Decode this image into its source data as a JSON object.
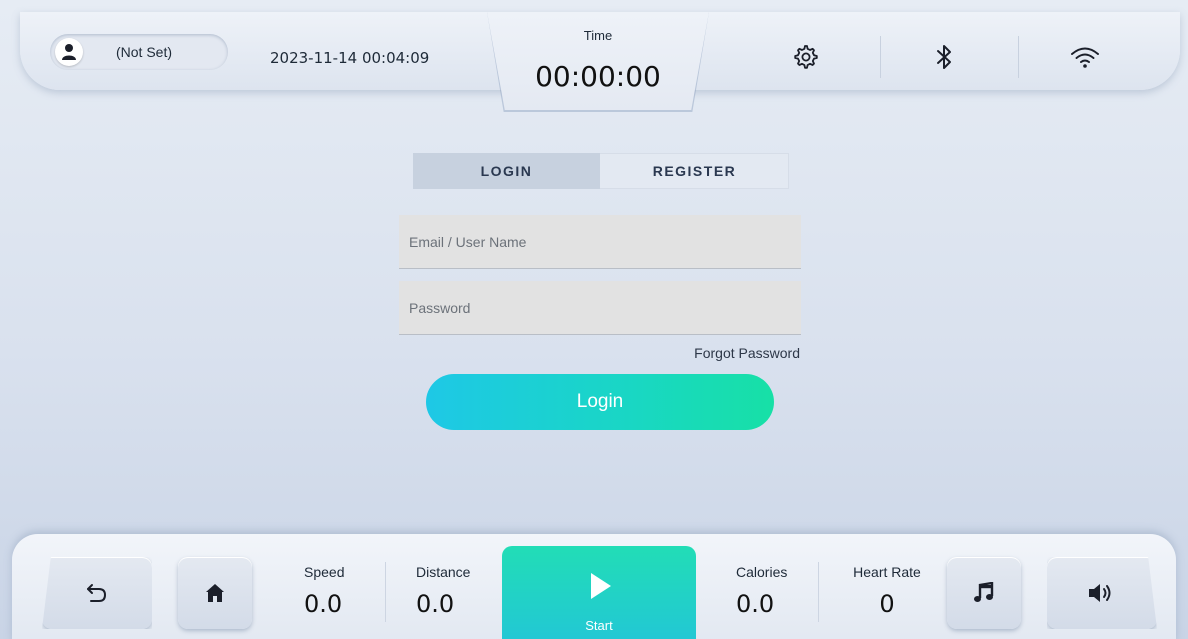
{
  "top_bar": {
    "user_name": "(Not Set)",
    "datetime": "2023-11-14 00:04:09",
    "time_label": "Time",
    "time_value": "00:00:00",
    "icons": [
      "settings-gear-icon",
      "bluetooth-icon",
      "wifi-icon"
    ]
  },
  "auth": {
    "tabs": [
      {
        "label": "LOGIN",
        "active": true
      },
      {
        "label": "REGISTER",
        "active": false
      }
    ],
    "email_placeholder": "Email / User Name",
    "email_value": "",
    "password_placeholder": "Password",
    "password_value": "",
    "forgot_password": "Forgot Password",
    "login_button": "Login"
  },
  "bottom_bar": {
    "back_icon": "back-arrow-icon",
    "home_icon": "home-icon",
    "metrics": [
      {
        "label": "Speed",
        "value": "0.0"
      },
      {
        "label": "Distance",
        "value": "0.0"
      },
      {
        "label": "Calories",
        "value": "0.0"
      },
      {
        "label": "Heart Rate",
        "value": "0"
      }
    ],
    "start_label": "Start",
    "music_icon": "music-note-icon",
    "volume_icon": "volume-icon"
  },
  "colors": {
    "accent_start": "#22ddb6",
    "login_gradient": [
      "#1ec8e6",
      "#17e0a6"
    ],
    "background": "#dde4ef"
  }
}
